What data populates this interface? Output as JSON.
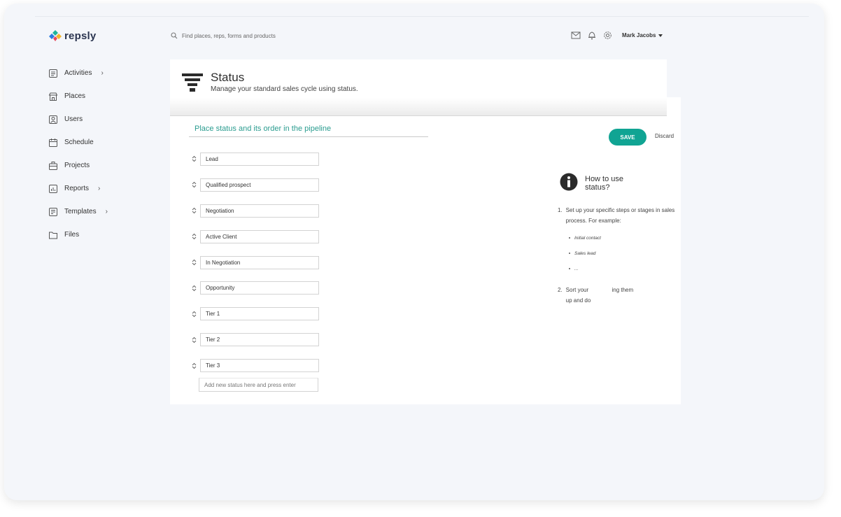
{
  "brand": {
    "name": "repsly"
  },
  "search": {
    "placeholder": "Find places, reps, forms and products"
  },
  "header": {
    "user_name": "Mark Jacobs"
  },
  "sidebar": {
    "items": [
      {
        "label": "Activities",
        "icon": "activities-icon",
        "has_children": true
      },
      {
        "label": "Places",
        "icon": "store-icon",
        "has_children": false
      },
      {
        "label": "Users",
        "icon": "user-icon",
        "has_children": false
      },
      {
        "label": "Schedule",
        "icon": "calendar-icon",
        "has_children": false
      },
      {
        "label": "Projects",
        "icon": "briefcase-icon",
        "has_children": false
      },
      {
        "label": "Reports",
        "icon": "chart-icon",
        "has_children": true
      },
      {
        "label": "Templates",
        "icon": "template-icon",
        "has_children": true
      },
      {
        "label": "Files",
        "icon": "folder-icon",
        "has_children": false
      }
    ]
  },
  "page": {
    "title": "Status",
    "subtitle": "Manage your standard sales cycle using status.",
    "pipeline_heading": "Place status and its order in the pipeline",
    "statuses": [
      "Lead",
      "Qualified prospect",
      "Negotiation",
      "Active Client",
      "In Negotiation",
      "Opportunity",
      "Tier 1",
      "Tier 2",
      "Tier 3"
    ],
    "new_status_placeholder": "Add new status here and press enter",
    "save_label": "SAVE",
    "discard_label": "Discard"
  },
  "help": {
    "title": "How to use status?",
    "step1_number": "1.",
    "step1_text": "Set up your specific steps or stages in sales process. For example:",
    "examples": [
      "Initial contact",
      "Sales lead",
      "..."
    ],
    "step2_number": "2.",
    "step2_text_visible_a": "Sort your",
    "step2_text_visible_b": "ing them",
    "step2_text_visible_c": "up and do"
  },
  "colors": {
    "accent": "#10a493",
    "heading": "#2a9c8f",
    "logo_text": "#2b3550"
  }
}
